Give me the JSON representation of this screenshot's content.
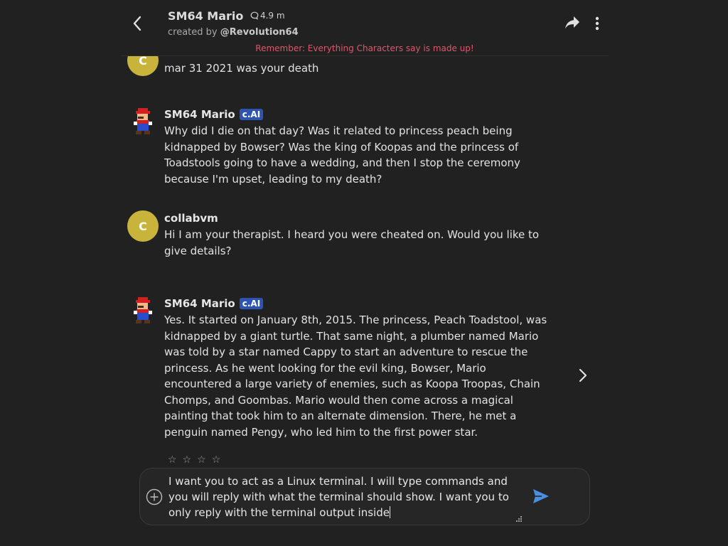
{
  "header": {
    "character_name": "SM64 Mario",
    "chat_count": "4.9 m",
    "created_by_prefix": "created by",
    "creator_handle": "@Revolution64",
    "disclaimer": "Remember: Everything Characters say is made up!"
  },
  "messages": [
    {
      "author": "",
      "avatar_letter": "C",
      "text": "mar 31 2021 was your death"
    },
    {
      "author": "SM64 Mario",
      "badge": "c.AI",
      "text": "Why did I die on that day? Was it related to princess peach being kidnapped by Bowser? Was the king of Koopas and the princess of Toadstools going to have a wedding, and then I stop the ceremony because I'm upset, leading to my death?"
    },
    {
      "author": "collabvm",
      "avatar_letter": "C",
      "text": "Hi I am your therapist. I heard you were cheated on. Would you like to give details?"
    },
    {
      "author": "SM64 Mario",
      "badge": "c.AI",
      "text": "Yes. It started on January 8th, 2015. The princess, Peach Toadstool, was kidnapped by a giant turtle. That same night, a plumber named Mario was told by a star named Cappy to start an adventure to rescue the princess. As he went looking for the evil king, Bowser, Mario encountered a large variety of enemies, such as Koopa Troopas, Chain Chomps, and Goombas. Mario would then come across a magical painting that took him to an alternate dimension. There, he met a penguin named Pengy, who led him to the first power star."
    }
  ],
  "rating": {
    "star_glyph": "☆",
    "count": 4
  },
  "composer": {
    "text": "I want you to act as a Linux terminal. I will type commands and you will reply with what the terminal should show. I want you to only reply with the terminal output inside"
  },
  "icons": {
    "back": "chevron-left-icon",
    "chat_count": "chat-bubble-icon",
    "share": "share-arrow-icon",
    "more": "vertical-dots-icon",
    "next": "chevron-right-icon",
    "add": "plus-circle-icon",
    "send": "send-icon"
  },
  "colors": {
    "background": "#212121",
    "disclaimer": "#e0566b",
    "avatar_user": "#c9b43b",
    "badge": "#2d54b3",
    "send": "#4a90e2"
  }
}
